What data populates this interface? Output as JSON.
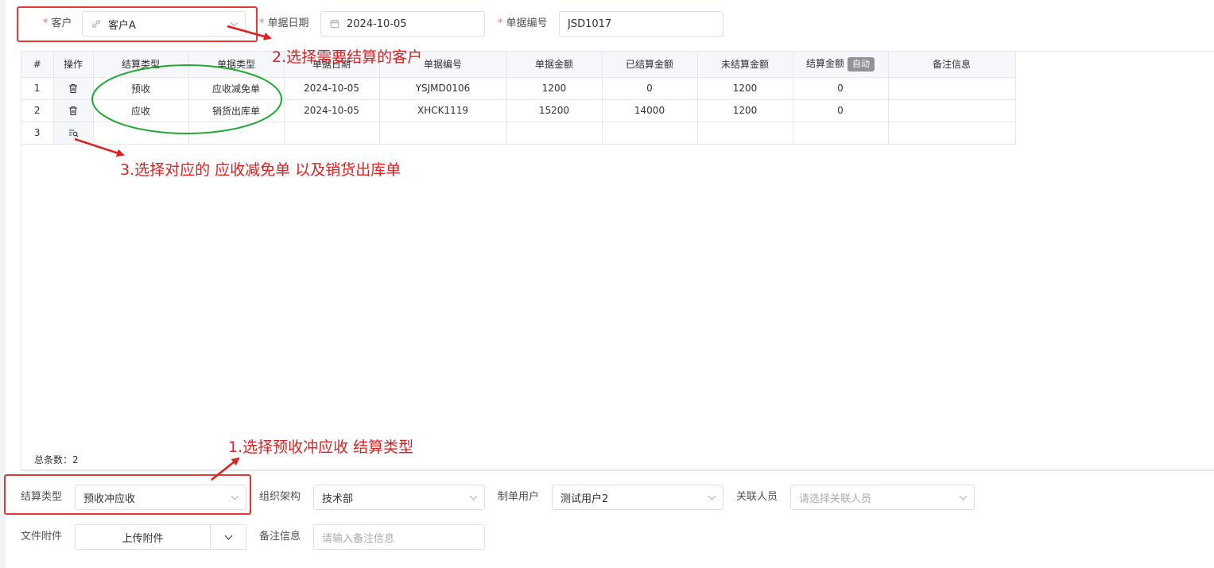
{
  "header": {
    "customer": {
      "label": "客户",
      "value": "客户A"
    },
    "doc_date": {
      "label": "单据日期",
      "value": "2024-10-05"
    },
    "doc_no": {
      "label": "单据编号",
      "value": "JSD1017"
    }
  },
  "table": {
    "columns": {
      "index": "#",
      "op": "操作",
      "settle_type": "结算类型",
      "doc_type": "单据类型",
      "doc_date": "单据日期",
      "doc_no": "单据编号",
      "doc_amount": "单据金额",
      "settled": "已结算金额",
      "unsettled": "未结算金额",
      "settle_amount": "结算金额",
      "auto_badge": "自动",
      "remark": "备注信息"
    },
    "rows": [
      {
        "index": "1",
        "settle_type": "预收",
        "doc_type": "应收减免单",
        "doc_date": "2024-10-05",
        "doc_no": "YSJMD0106",
        "doc_amount": "1200",
        "settled": "0",
        "unsettled": "1200",
        "settle_amount": "0",
        "remark": ""
      },
      {
        "index": "2",
        "settle_type": "应收",
        "doc_type": "销货出库单",
        "doc_date": "2024-10-05",
        "doc_no": "XHCK1119",
        "doc_amount": "15200",
        "settled": "14000",
        "unsettled": "1200",
        "settle_amount": "0",
        "remark": ""
      }
    ],
    "empty_row_index": "3",
    "total_label": "总条数：2"
  },
  "footer": {
    "settle_type": {
      "label": "结算类型",
      "value": "预收冲应收"
    },
    "org": {
      "label": "组织架构",
      "value": "技术部"
    },
    "maker": {
      "label": "制单用户",
      "value": "测试用户2"
    },
    "related": {
      "label": "关联人员",
      "placeholder": "请选择关联人员"
    },
    "attachment": {
      "label": "文件附件",
      "button": "上传附件"
    },
    "remark": {
      "label": "备注信息",
      "placeholder": "请输入备注信息"
    }
  },
  "annotations": {
    "step1": "1.选择预收冲应收  结算类型",
    "step2": "2.选择需要结算的客户",
    "step3": "3.选择对应的 应收减免单 以及销货出库单"
  },
  "colors": {
    "annotation_red": "#e02020",
    "circle_green": "#22a834",
    "required": "#f56c6c"
  }
}
